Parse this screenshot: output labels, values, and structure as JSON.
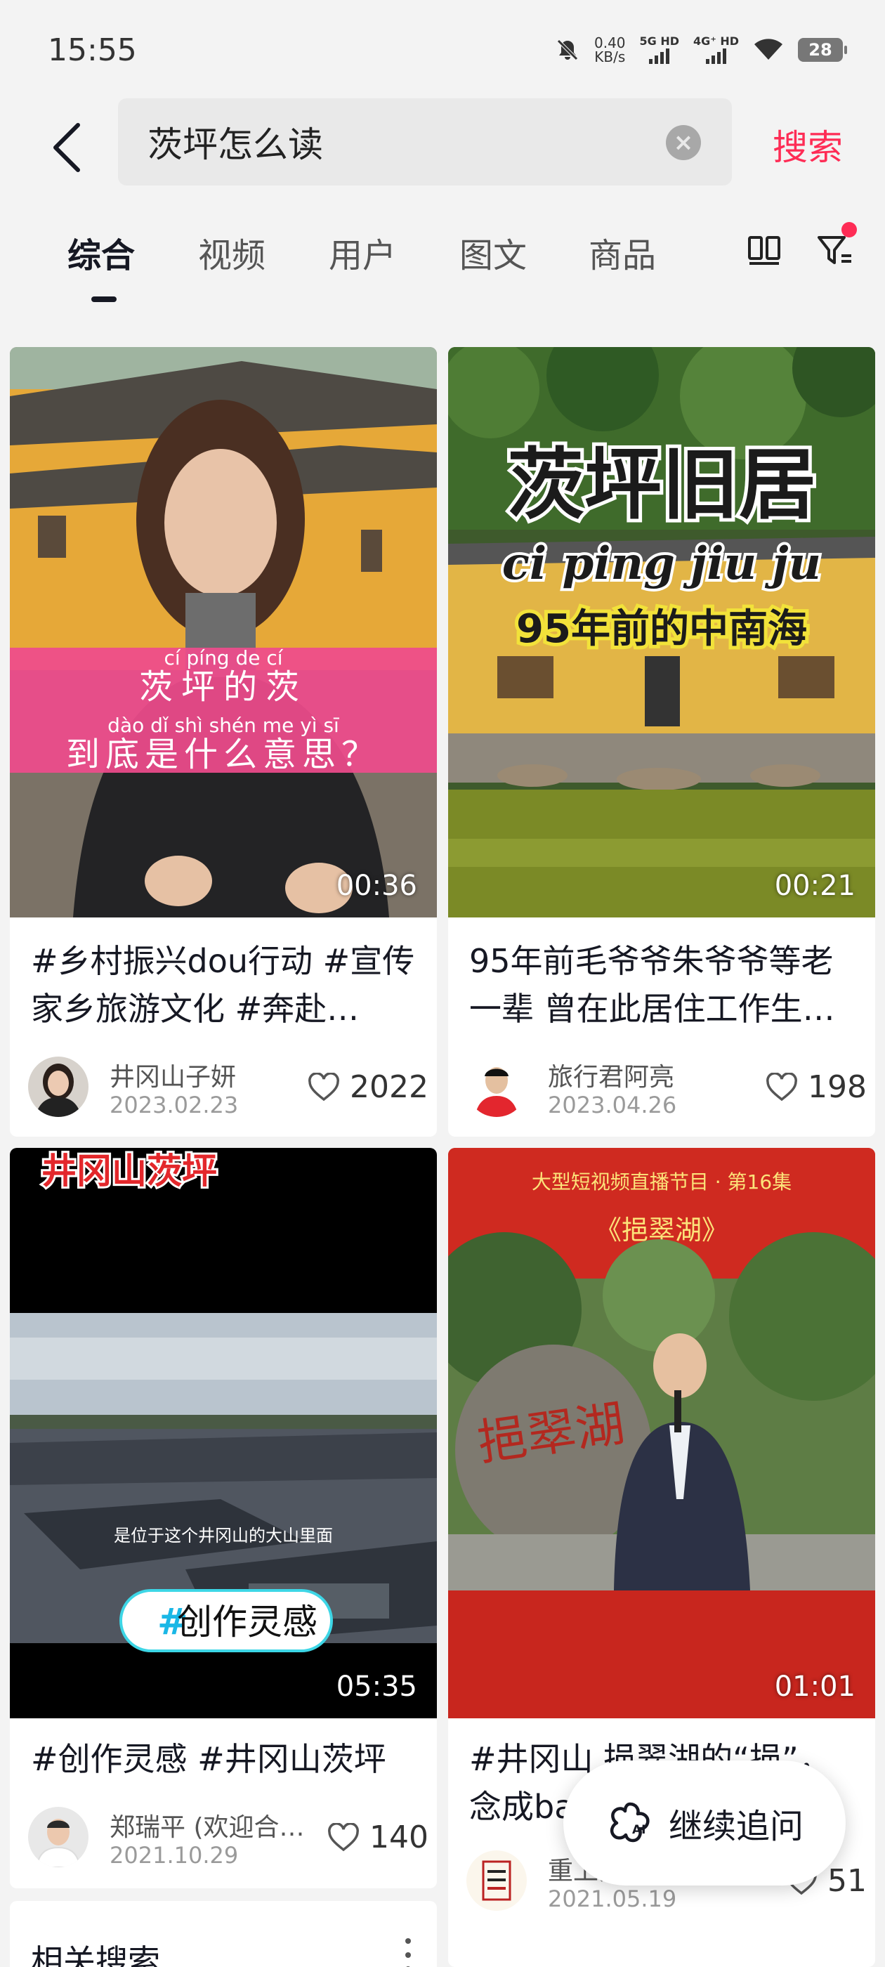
{
  "status_bar": {
    "time": "15:55",
    "speed_value": "0.40",
    "speed_unit": "KB/s",
    "sim1": "5G HD",
    "sim2": "4G⁺ HD",
    "battery": "28"
  },
  "search": {
    "query": "茨坪怎么读",
    "submit_label": "搜索"
  },
  "tabs": [
    {
      "label": "综合",
      "active": true
    },
    {
      "label": "视频"
    },
    {
      "label": "用户"
    },
    {
      "label": "图文"
    },
    {
      "label": "商品"
    }
  ],
  "results": [
    {
      "title": "#乡村振兴dou行动 #宣传家乡旅游文化 #奔赴…",
      "author": "井冈山子妍",
      "date": "2023.02.23",
      "likes": "2022",
      "duration": "00:36",
      "overlay": {
        "line1_pinyin": "cí   píng   de   cí",
        "line1": "茨坪的茨",
        "line2_pinyin": "dào   dǐ   shì   shén  me   yì   sī",
        "line2": "到底是什么意思？"
      }
    },
    {
      "title": "95年前毛爷爷朱爷爷等老一辈 曾在此居住工作生…",
      "author": "旅行君阿亮",
      "date": "2023.04.26",
      "likes": "198",
      "duration": "00:21",
      "overlay": {
        "headline": "茨坪旧居",
        "pinyin": "ci ping jiu ju",
        "subtitle": "95年前的中南海"
      }
    },
    {
      "title": "#创作灵感 #井冈山茨坪",
      "author": "郑瑞平 (欢迎合…",
      "date": "2021.10.29",
      "likes": "140",
      "duration": "05:35",
      "overlay": {
        "top": "井冈山茨坪",
        "caption": "是位于这个井冈山的大山里面",
        "hashtag": "创作灵感"
      }
    },
    {
      "title": "#井冈山 挹翠湖的“挹”，念成ba…",
      "author": "重上井",
      "date": "2021.05.19",
      "likes": "51",
      "duration": "01:01",
      "overlay": {
        "banner": "大型短视频直播节目 · 第16集",
        "name": "《挹翠湖》"
      }
    }
  ],
  "related": {
    "title": "相关搜索"
  },
  "continue_button": {
    "label": "继续追问"
  },
  "colors": {
    "accent": "#fe2c55",
    "background": "#f3f3f3"
  },
  "icons": [
    "back-arrow-icon",
    "clear-icon",
    "layout-toggle-icon",
    "filter-icon",
    "heart-icon",
    "ai-icon",
    "more-icon"
  ]
}
